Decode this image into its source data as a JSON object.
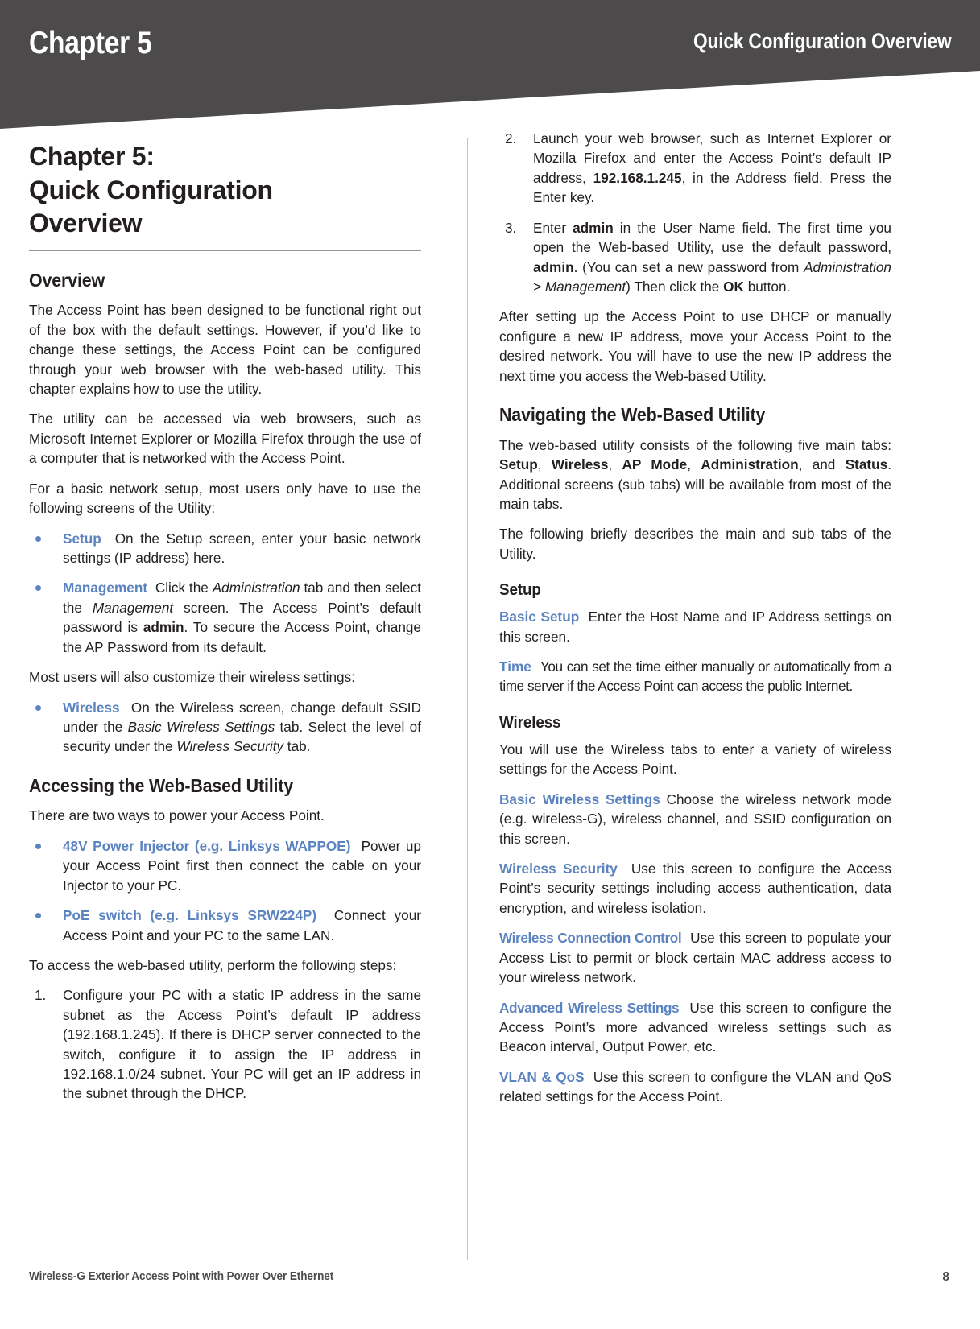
{
  "header": {
    "chapter_label": "Chapter 5",
    "section_title": "Quick Configuration Overview",
    "banner_color": "#4d4a4b"
  },
  "accent_color": "#5b83c0",
  "document": {
    "title_line1": "Chapter 5:",
    "title_line2": "Quick Configuration",
    "title_line3": "Overview"
  },
  "left_column": {
    "overview_heading": "Overview",
    "overview_p1": "The Access Point has been designed to be functional right out of the box with the default settings. However, if you’d like to change these settings, the Access Point can be configured through your web browser with the web-based utility. This chapter explains how to use the utility.",
    "overview_p2": "The utility can be accessed via web browsers, such as Microsoft Internet Explorer or Mozilla Firefox through the use of a computer that is networked with the Access Point.",
    "overview_p3": "For a basic network setup, most users only have to use the following screens of the Utility:",
    "bullet_setup_label": "Setup",
    "bullet_setup_text": "On the Setup screen, enter your basic network settings (IP address) here.",
    "bullet_management_label": "Management",
    "bullet_management_t1": "Click the ",
    "bullet_management_i1": "Administration",
    "bullet_management_t2": " tab and then select the ",
    "bullet_management_i2": "Management",
    "bullet_management_t3": " screen. The Access Point’s default password is ",
    "bullet_management_b1": "admin",
    "bullet_management_t4": ". To secure the Access Point, change the AP Password from its default.",
    "wireless_intro": "Most users will also customize their wireless settings:",
    "bullet_wireless_label": "Wireless",
    "bullet_wireless_t1": "On the Wireless screen, change default SSID under the ",
    "bullet_wireless_i1": "Basic Wireless Settings",
    "bullet_wireless_t2": " tab. Select the level of security under the ",
    "bullet_wireless_i2": "Wireless Security",
    "bullet_wireless_t3": " tab.",
    "accessing_heading": "Accessing the Web-Based Utility",
    "accessing_p1": "There are two ways to power your Access Point.",
    "bullet_injector_label": "48V Power Injector (e.g. Linksys WAPPOE)",
    "bullet_injector_text": "Power up your Access Point first then connect the cable on your Injector to your PC.",
    "bullet_poe_label": "PoE switch (e.g. Linksys SRW224P)",
    "bullet_poe_text": "Connect your Access Point and your PC to the same LAN.",
    "accessing_p2": "To access the web-based utility, perform the following steps:",
    "step1_num": "1.",
    "step1_text": "Configure your PC with a static IP address in the same subnet as the Access Point’s default IP address (192.168.1.245). If there is DHCP server connected to the switch, configure it to assign the IP address in 192.168.1.0/24 subnet. Your PC will get an IP address in the subnet through the DHCP."
  },
  "right_column": {
    "step2_num": "2.",
    "step2_t1": "Launch your web browser, such as Internet Explorer or Mozilla Firefox and enter the Access Point’s default IP address, ",
    "step2_b1": "192.168.1.245",
    "step2_t2": ", in the Address field. Press the Enter key.",
    "step3_num": "3.",
    "step3_t1": "Enter ",
    "step3_b1": "admin",
    "step3_t2": " in the User Name field. The first time you open the Web-based Utility, use the default password, ",
    "step3_b2": "admin",
    "step3_t3": ". (You can set a new password from ",
    "step3_i1": "Administration",
    "step3_t4": " > ",
    "step3_i2": "Management",
    "step3_t5": ") Then click the ",
    "step3_b3": "OK",
    "step3_t6": " button.",
    "after_p": "After setting up the Access Point to use DHCP or manually configure a new IP address, move your Access Point to the desired network. You will have to use the new IP address the next time you access the Web-based Utility.",
    "navigating_heading": "Navigating the Web-Based Utility",
    "nav_t1": "The web-based utility consists of the following five main tabs: ",
    "nav_b1": "Setup",
    "nav_t2": ", ",
    "nav_b2": "Wireless",
    "nav_t3": ", ",
    "nav_b3": "AP Mode",
    "nav_t4": ", ",
    "nav_b4": "Administration",
    "nav_t5": ", and ",
    "nav_b5": "Status",
    "nav_t6": ". Additional screens (sub tabs) will be available from most of the main tabs.",
    "nav_p2": "The following briefly describes the main and sub tabs of the Utility.",
    "setup_heading": "Setup",
    "basic_setup_label": "Basic Setup",
    "basic_setup_text": "Enter the Host Name and IP Address settings on this screen.",
    "time_label": "Time",
    "time_text": "You can set the time either manually or automatically from a time server if the Access Point can access the public Internet.",
    "wireless_heading": "Wireless",
    "wireless_p1": "You will use the Wireless tabs to enter a variety of wireless settings for the Access Point.",
    "bws_label": "Basic Wireless Settings",
    "bws_text": "Choose the wireless network mode (e.g. wireless-G), wireless channel, and SSID configuration on this screen.",
    "ws_label": "Wireless Security",
    "ws_text": "Use this screen to configure the Access Point’s security settings including access authentication, data encryption, and wireless isolation.",
    "wcc_label": "Wireless Connection Control",
    "wcc_text": "Use this screen to populate your Access List to permit or block certain MAC address access to your wireless network.",
    "aws_label": "Advanced Wireless Settings",
    "aws_text": "Use this screen to configure the Access Point’s more advanced wireless settings such as Beacon interval, Output Power, etc.",
    "vlan_label": "VLAN & QoS",
    "vlan_text": "Use this screen to configure the VLAN and QoS related settings for the Access Point."
  },
  "footer": {
    "product_name": "Wireless-G Exterior Access Point with Power Over Ethernet",
    "page_number": "8"
  }
}
